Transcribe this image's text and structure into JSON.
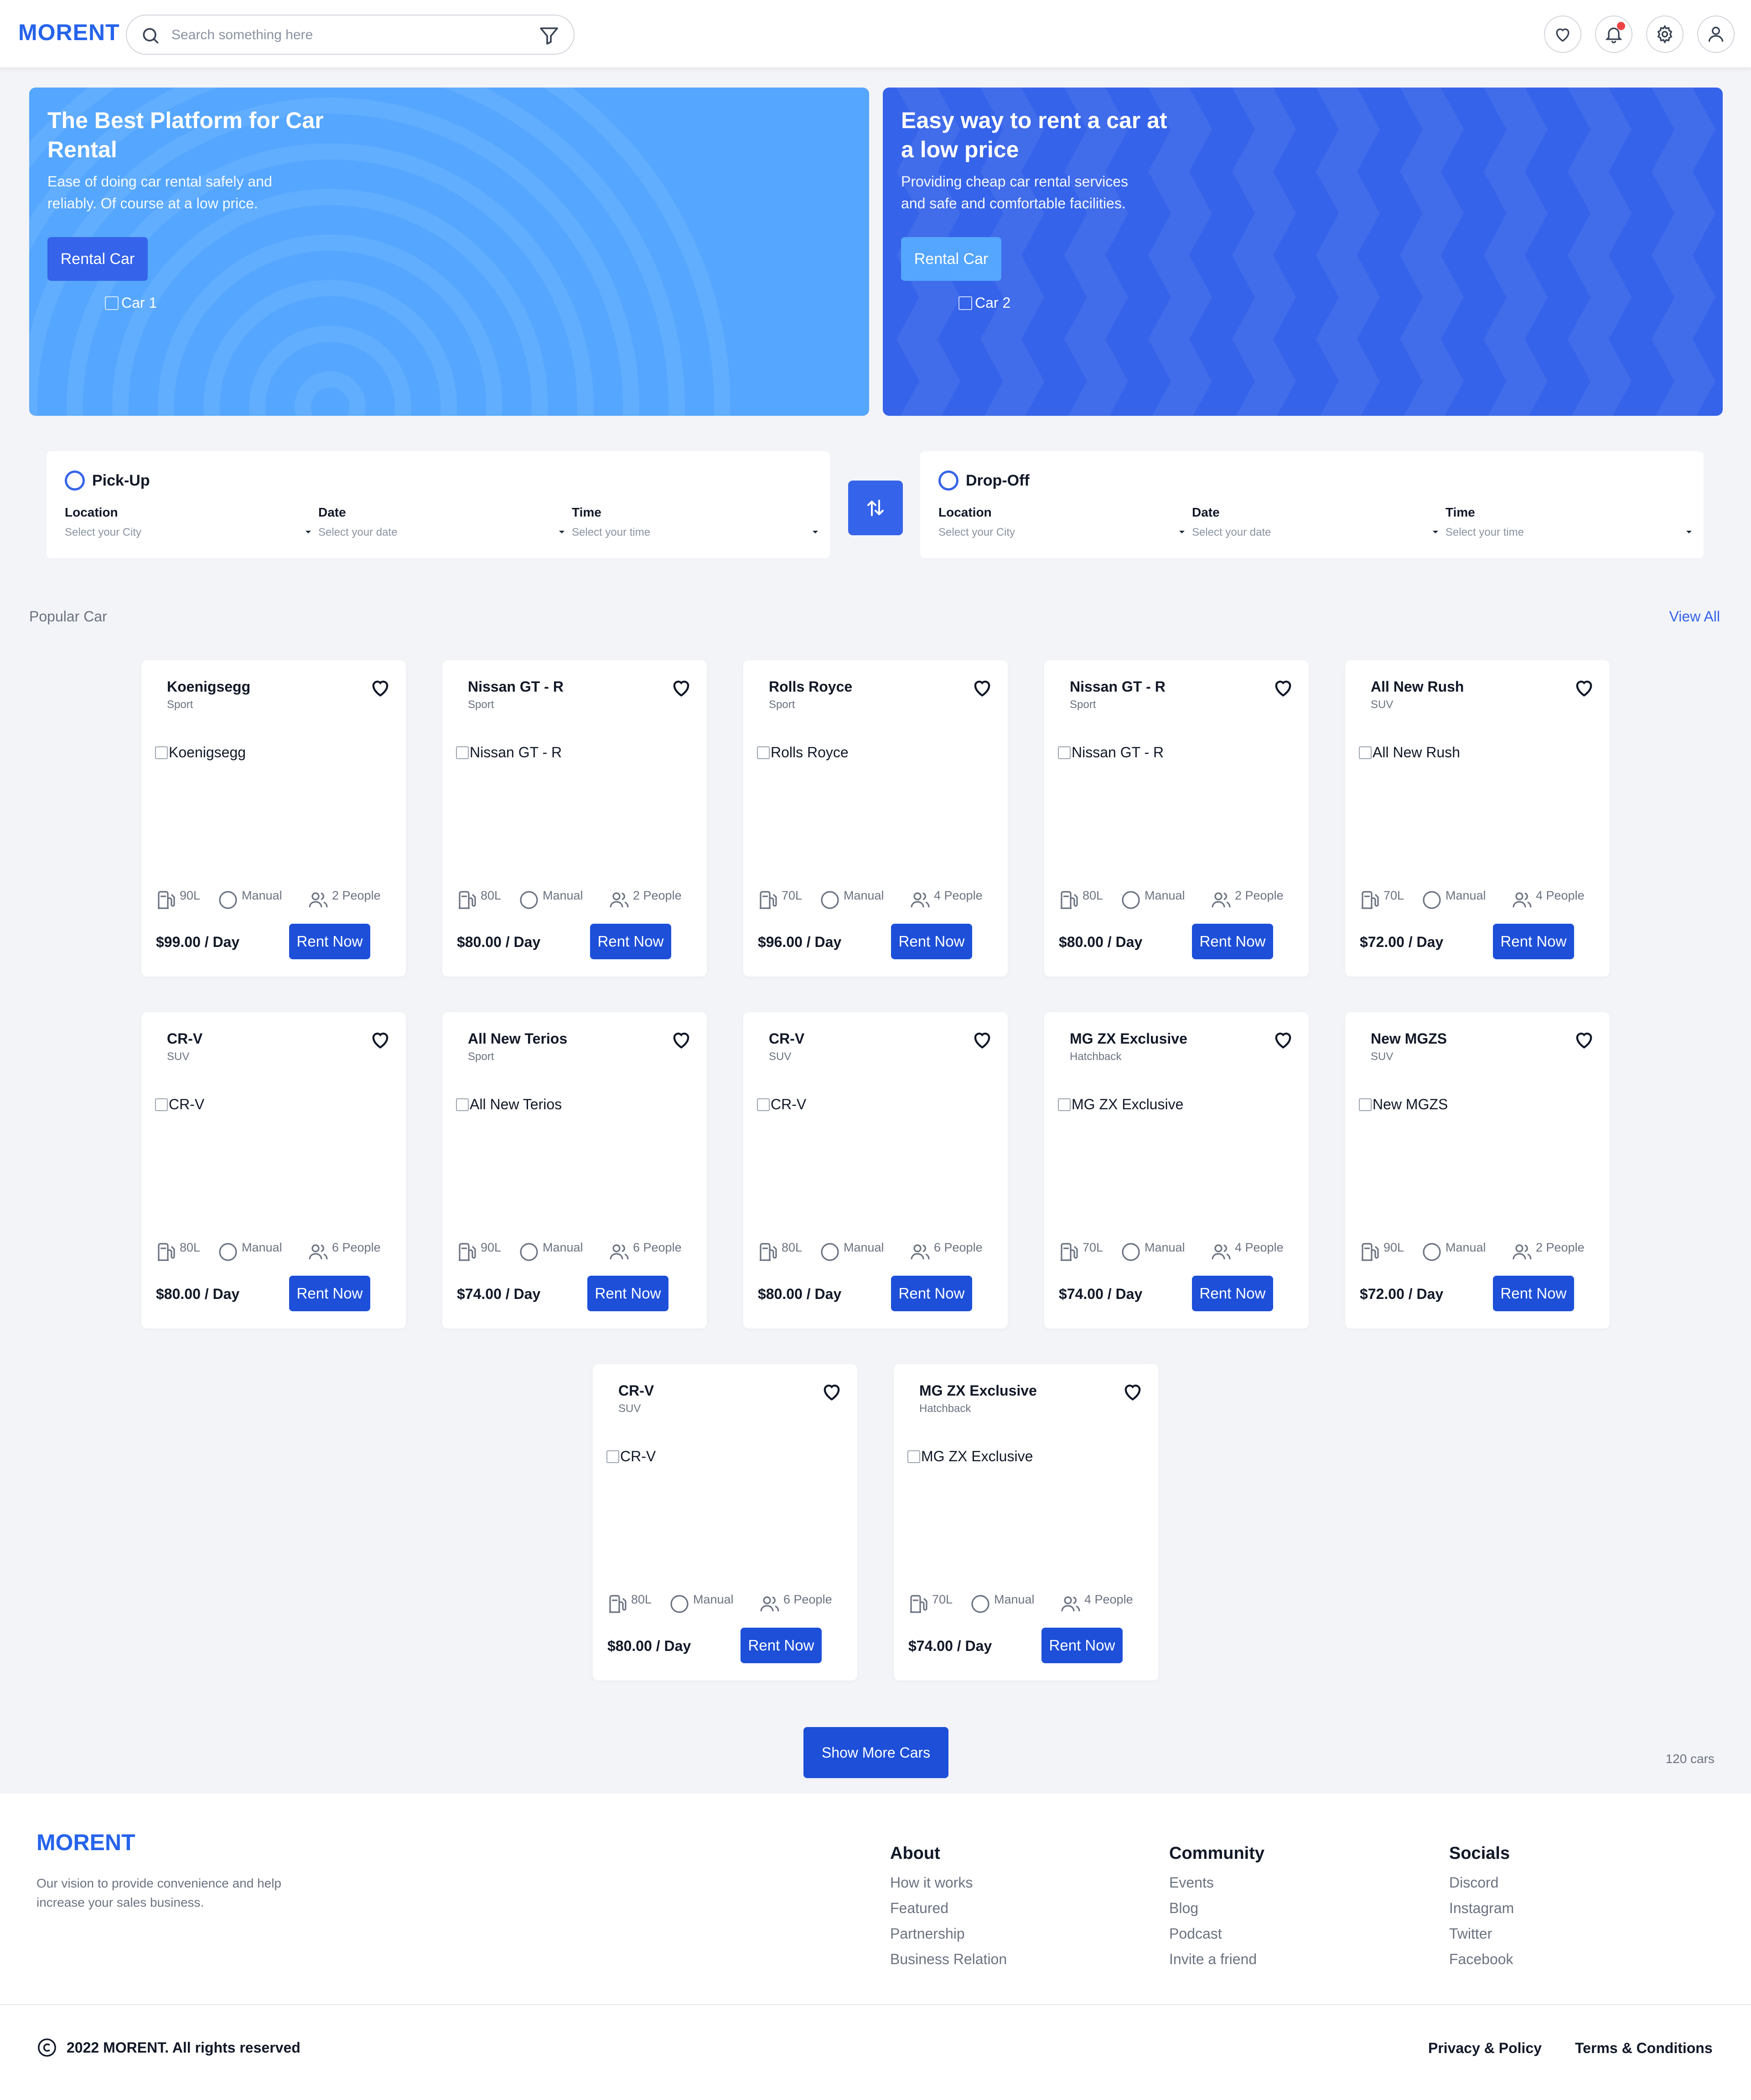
{
  "header": {
    "logo": "MORENT",
    "search_placeholder": "Search something here",
    "icons": [
      "heart-icon",
      "bell-icon",
      "gear-icon",
      "user-icon"
    ]
  },
  "hero": [
    {
      "title": "The Best Platform for Car Rental",
      "description": "Ease of doing car rental safely and reliably. Of course at a low price.",
      "button": "Rental Car",
      "image_alt": "Car 1"
    },
    {
      "title": "Easy way to rent a car at a low price",
      "description": "Providing cheap car rental services and safe and comfortable facilities.",
      "button": "Rental Car",
      "image_alt": "Car 2"
    }
  ],
  "pickup": {
    "title": "Pick-Up",
    "fields": [
      {
        "label": "Location",
        "placeholder": "Select your City"
      },
      {
        "label": "Date",
        "placeholder": "Select your date"
      },
      {
        "label": "Time",
        "placeholder": "Select your time"
      }
    ]
  },
  "dropoff": {
    "title": "Drop-Off",
    "fields": [
      {
        "label": "Location",
        "placeholder": "Select your City"
      },
      {
        "label": "Date",
        "placeholder": "Select your date"
      },
      {
        "label": "Time",
        "placeholder": "Select your time"
      }
    ]
  },
  "popular": {
    "title": "Popular Car",
    "view_all": "View All",
    "rent_label": "Rent Now",
    "cars": [
      {
        "name": "Koenigsegg",
        "type": "Sport",
        "fuel": "90L",
        "transmission": "Manual",
        "capacity": "2 People",
        "price": "$99.00 / Day"
      },
      {
        "name": "Nissan GT - R",
        "type": "Sport",
        "fuel": "80L",
        "transmission": "Manual",
        "capacity": "2 People",
        "price": "$80.00 / Day"
      },
      {
        "name": "Rolls Royce",
        "type": "Sport",
        "fuel": "70L",
        "transmission": "Manual",
        "capacity": "4 People",
        "price": "$96.00 / Day"
      },
      {
        "name": "Nissan GT - R",
        "type": "Sport",
        "fuel": "80L",
        "transmission": "Manual",
        "capacity": "2 People",
        "price": "$80.00 / Day"
      },
      {
        "name": "All New Rush",
        "type": "SUV",
        "fuel": "70L",
        "transmission": "Manual",
        "capacity": "4 People",
        "price": "$72.00 / Day"
      },
      {
        "name": "CR-V",
        "type": "SUV",
        "fuel": "80L",
        "transmission": "Manual",
        "capacity": "6 People",
        "price": "$80.00 / Day"
      },
      {
        "name": "All New Terios",
        "type": "Sport",
        "fuel": "90L",
        "transmission": "Manual",
        "capacity": "6 People",
        "price": "$74.00 / Day"
      },
      {
        "name": "CR-V",
        "type": "SUV",
        "fuel": "80L",
        "transmission": "Manual",
        "capacity": "6 People",
        "price": "$80.00 / Day"
      },
      {
        "name": "MG ZX Exclusive",
        "type": "Hatchback",
        "fuel": "70L",
        "transmission": "Manual",
        "capacity": "4 People",
        "price": "$74.00 / Day"
      },
      {
        "name": "New MGZS",
        "type": "SUV",
        "fuel": "90L",
        "transmission": "Manual",
        "capacity": "2 People",
        "price": "$72.00 / Day"
      },
      {
        "name": "CR-V",
        "type": "SUV",
        "fuel": "80L",
        "transmission": "Manual",
        "capacity": "6 People",
        "price": "$80.00 / Day"
      },
      {
        "name": "MG ZX Exclusive",
        "type": "Hatchback",
        "fuel": "70L",
        "transmission": "Manual",
        "capacity": "4 People",
        "price": "$74.00 / Day"
      }
    ],
    "show_more": "Show More Cars",
    "count": "120 cars"
  },
  "footer": {
    "logo": "MORENT",
    "description": "Our vision to provide convenience and help increase your sales business.",
    "columns": [
      {
        "title": "About",
        "links": [
          "How it works",
          "Featured",
          "Partnership",
          "Business Relation"
        ]
      },
      {
        "title": "Community",
        "links": [
          "Events",
          "Blog",
          "Podcast",
          "Invite a friend"
        ]
      },
      {
        "title": "Socials",
        "links": [
          "Discord",
          "Instagram",
          "Twitter",
          "Facebook"
        ]
      }
    ],
    "copyright": "2022 MORENT. All rights reserved",
    "privacy": "Privacy & Policy",
    "terms": "Terms & Conditions"
  },
  "colors": {
    "primary": "#3563e9",
    "light_blue": "#54a6ff",
    "button_blue": "#1d4fd8",
    "notification": "#ef4444"
  }
}
